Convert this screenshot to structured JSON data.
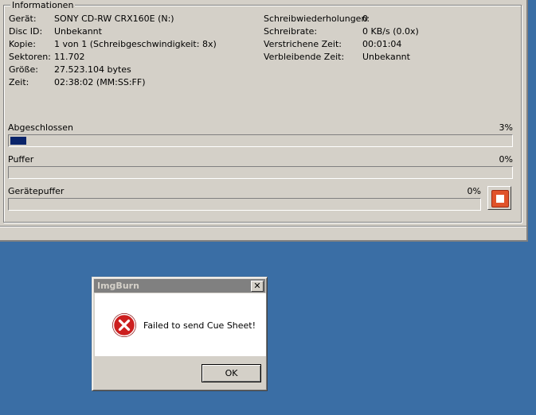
{
  "info": {
    "legend": "Informationen",
    "left": [
      {
        "label": "Gerät:",
        "value": "SONY CD-RW CRX160E (N:)"
      },
      {
        "label": "Disc ID:",
        "value": "Unbekannt"
      },
      {
        "label": "Kopie:",
        "value": "1 von 1 (Schreibgeschwindigkeit: 8x)"
      },
      {
        "label": "Sektoren:",
        "value": "11.702"
      },
      {
        "label": "Größe:",
        "value": "27.523.104 bytes"
      },
      {
        "label": "Zeit:",
        "value": "02:38:02 (MM:SS:FF)"
      }
    ],
    "right": [
      {
        "label": "Schreibwiederholungen:",
        "value": "0"
      },
      {
        "label": "Schreibrate:",
        "value": "0 KB/s (0.0x)"
      },
      {
        "label": "Verstrichene Zeit:",
        "value": "00:01:04"
      },
      {
        "label": "Verbleibende Zeit:",
        "value": "Unbekannt"
      }
    ]
  },
  "progress": {
    "completed": {
      "label": "Abgeschlossen",
      "percent_text": "3%",
      "fraction": 0.03
    },
    "buffer": {
      "label": "Puffer",
      "percent_text": "0%",
      "fraction": 0
    },
    "device_buffer": {
      "label": "Gerätepuffer",
      "percent_text": "0%",
      "fraction": 0
    }
  },
  "dialog": {
    "title": "ImgBurn",
    "close_glyph": "✕",
    "message": "Failed to send Cue Sheet!",
    "ok_label": "OK",
    "icon": "error-icon"
  },
  "colors": {
    "desktop": "#3a6ea5",
    "progress_fill": "#0a246a",
    "stop_red": "#e0532a",
    "error_red": "#cc1f1f"
  }
}
